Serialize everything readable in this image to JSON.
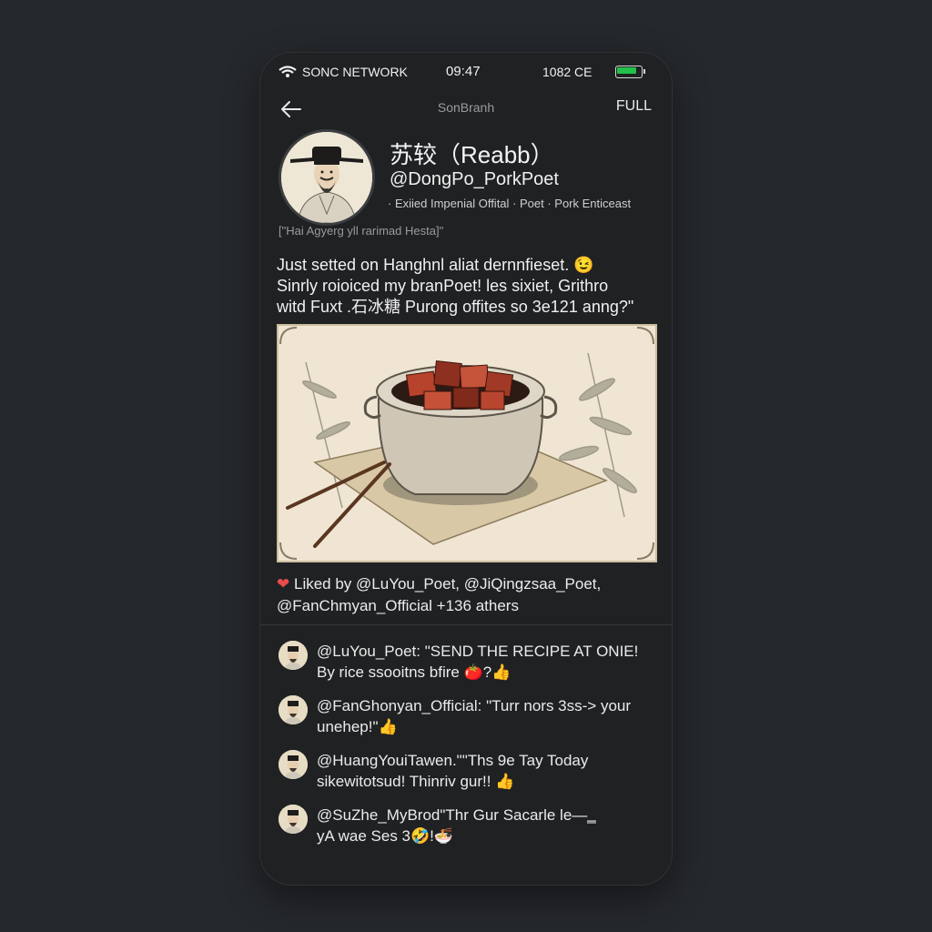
{
  "status_bar": {
    "network_name": "SONC NETWORK",
    "time": "09:47",
    "cell_text": "1082 CE",
    "battery_level": 0.85,
    "battery_color": "#23c04a"
  },
  "nav": {
    "back_icon": "arrow-left-icon",
    "title": "SonBranh",
    "full_label": "FULL"
  },
  "profile": {
    "display_name": "苏较（Reabb）",
    "handle": "@DongPo_PorkPoet",
    "bio": "· Exiied Impenial Offital · Poet · Pork Enticeast",
    "quote": "[\"Hai Agyerg yll rarimad Hesta]\""
  },
  "post": {
    "text_lines": [
      "Just setted on Hanghnl aliat dernnfieset. 😉",
      "Sinrly roioiced my branPoet! les sixiet, Grithro",
      "witd Fuxt .石冰糖 Purong offites so 3e121 anng?\""
    ],
    "image_alt": "Ink-wash painting of a clay pot of braised pork with chopsticks and bamboo"
  },
  "likes": {
    "line1": "Liked by @LuYou_Poet, @JiQingzsaa_Poet,",
    "line2": "@FanChmyan_Official +136 athers"
  },
  "comments": [
    {
      "line1": "@LuYou_Poet: \"SEND THE RECIPE AT ONIE!",
      "line2": "By rice ssooitns bfire 🍅?👍"
    },
    {
      "line1": "@FanGhonyan_Official: \"Turr nors 3ss-> your",
      "line2": "unehep!\"👍"
    },
    {
      "line1": "@HuangYouiTawen.\"\"Ths 9e Tay Today",
      "line2": "sikewitotsud! Thinriv gur!! 👍"
    },
    {
      "line1": "@SuZhe_MyBrod\"Thr Gur Sacarle le—‗",
      "line2": "yA wae Ses 3🤣!🍜"
    }
  ]
}
